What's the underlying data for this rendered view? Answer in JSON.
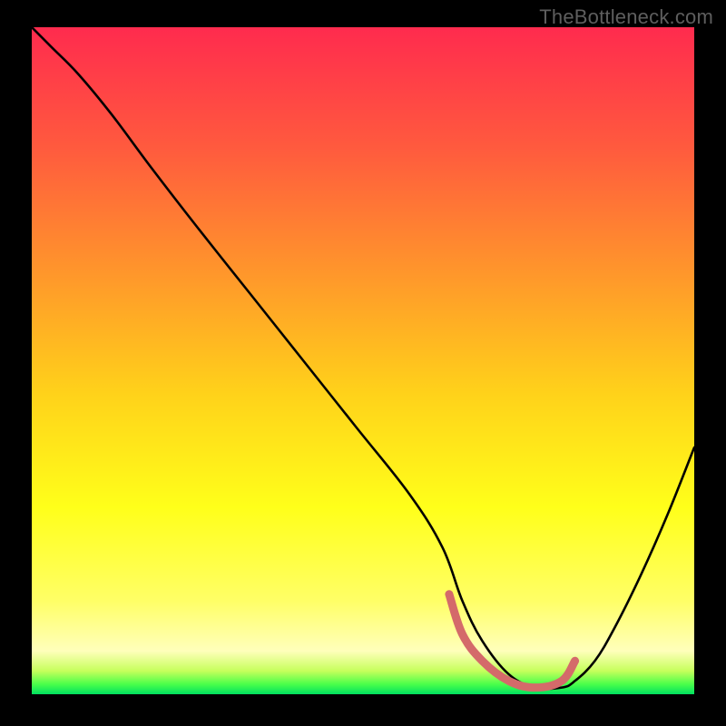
{
  "watermark": "TheBottleneck.com",
  "chart_data": {
    "type": "line",
    "title": "",
    "xlabel": "",
    "ylabel": "",
    "xlim": [
      0,
      100
    ],
    "ylim": [
      0,
      100
    ],
    "grid": false,
    "legend": false,
    "background_gradient": {
      "stops": [
        {
          "offset": 0.0,
          "color": "#ff2b4e"
        },
        {
          "offset": 0.18,
          "color": "#ff5a3e"
        },
        {
          "offset": 0.38,
          "color": "#ff9a2a"
        },
        {
          "offset": 0.55,
          "color": "#ffd21a"
        },
        {
          "offset": 0.72,
          "color": "#ffff1a"
        },
        {
          "offset": 0.86,
          "color": "#ffff66"
        },
        {
          "offset": 0.935,
          "color": "#ffffbb"
        },
        {
          "offset": 0.965,
          "color": "#c6ff5c"
        },
        {
          "offset": 0.985,
          "color": "#4aff4a"
        },
        {
          "offset": 1.0,
          "color": "#00e060"
        }
      ]
    },
    "series": [
      {
        "name": "bottleneck-curve",
        "color": "#000000",
        "x": [
          0,
          3,
          7,
          12,
          18,
          25,
          33,
          41,
          49,
          57,
          62,
          65,
          68,
          72,
          76,
          80,
          82,
          85,
          88,
          92,
          96,
          100
        ],
        "y": [
          100,
          97,
          93,
          87,
          79,
          70,
          60,
          50,
          40,
          30,
          22,
          14,
          8,
          3,
          1,
          1,
          2,
          5,
          10,
          18,
          27,
          37
        ]
      }
    ],
    "highlight_segment": {
      "name": "bottleneck-low-zone",
      "color": "#d46a6a",
      "x": [
        63,
        65,
        68,
        72,
        76,
        80,
        82
      ],
      "y": [
        15,
        9,
        5,
        2,
        1,
        2,
        5
      ]
    }
  }
}
